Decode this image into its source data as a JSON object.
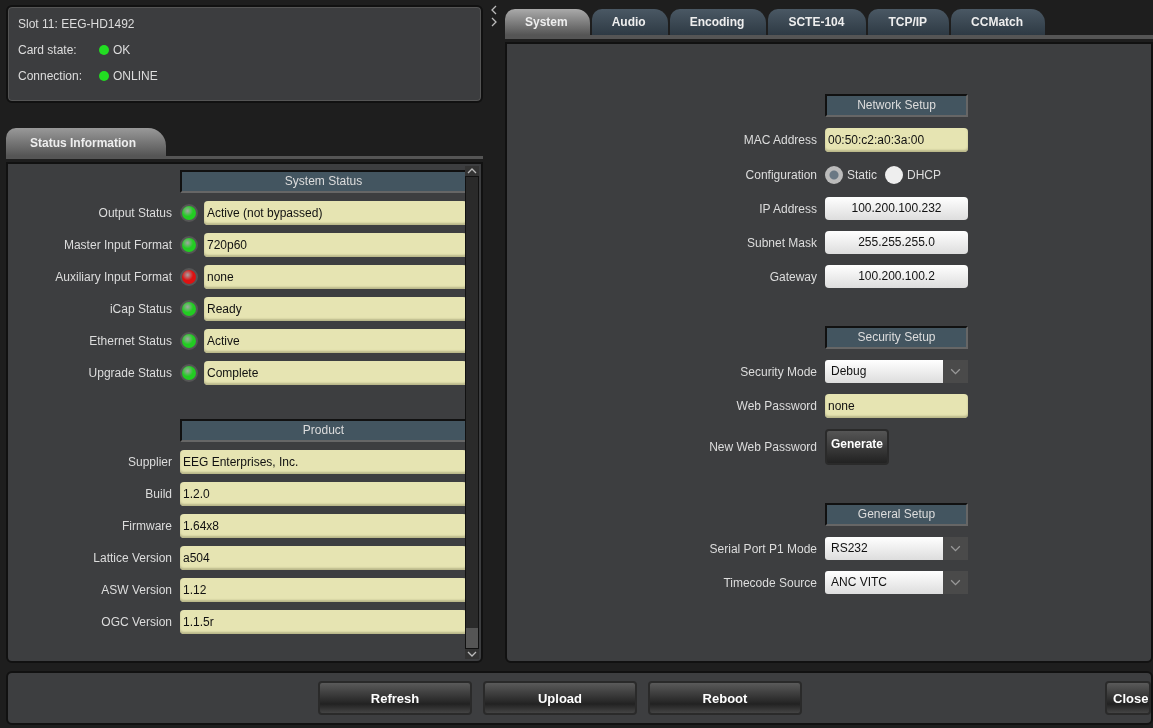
{
  "card": {
    "slot": "Slot 11: EEG-HD1492",
    "lines": [
      {
        "label": "Card state:",
        "value": "OK",
        "color": "#22dd22"
      },
      {
        "label": "Connection:",
        "value": "ONLINE",
        "color": "#22dd22"
      }
    ]
  },
  "left_tabs": [
    {
      "label": "Status Information",
      "selected": true
    }
  ],
  "status_sections": [
    {
      "title": "System Status",
      "rows": [
        {
          "label": "Output Status",
          "value": "Active (not bypassed)",
          "color": "#22cc22"
        },
        {
          "label": "Master Input Format",
          "value": "720p60",
          "color": "#22cc22"
        },
        {
          "label": "Auxiliary Input Format",
          "value": "none",
          "color": "#dd1111"
        },
        {
          "label": "iCap Status",
          "value": "Ready",
          "color": "#22cc22"
        },
        {
          "label": "Ethernet Status",
          "value": "Active",
          "color": "#22cc22"
        },
        {
          "label": "Upgrade Status",
          "value": "Complete",
          "color": "#22cc22"
        }
      ]
    },
    {
      "title": "Product",
      "rows": [
        {
          "label": "Supplier",
          "value": "EEG Enterprises, Inc."
        },
        {
          "label": "Build",
          "value": "1.2.0"
        },
        {
          "label": "Firmware",
          "value": "1.64x8"
        },
        {
          "label": "Lattice Version",
          "value": "a504"
        },
        {
          "label": "ASW Version",
          "value": "1.12"
        },
        {
          "label": "OGC Version",
          "value": "1.1.5r"
        }
      ]
    }
  ],
  "tabs": [
    {
      "label": "System",
      "selected": true
    },
    {
      "label": "Audio",
      "selected": false
    },
    {
      "label": "Encoding",
      "selected": false
    },
    {
      "label": "SCTE-104",
      "selected": false
    },
    {
      "label": "TCP/IP",
      "selected": false
    },
    {
      "label": "CCMatch",
      "selected": false
    }
  ],
  "settings_sections": [
    {
      "title": "Network Setup",
      "rows": [
        {
          "kind": "readonly",
          "label": "MAC Address",
          "value": "00:50:c2:a0:3a:00"
        },
        {
          "kind": "radio",
          "label": "Configuration",
          "options": [
            {
              "label": "Static",
              "selected": true
            },
            {
              "label": "DHCP",
              "selected": false
            }
          ]
        },
        {
          "kind": "input",
          "label": "IP Address",
          "value": "100.200.100.232"
        },
        {
          "kind": "input",
          "label": "Subnet Mask",
          "value": "255.255.255.0"
        },
        {
          "kind": "input",
          "label": "Gateway",
          "value": "100.200.100.2"
        }
      ]
    },
    {
      "title": "Security Setup",
      "rows": [
        {
          "kind": "select",
          "label": "Security Mode",
          "value": "Debug"
        },
        {
          "kind": "readonly",
          "label": "Web Password",
          "value": "none"
        },
        {
          "kind": "button",
          "label": "New Web Password",
          "value": "Generate"
        }
      ]
    },
    {
      "title": "General Setup",
      "rows": [
        {
          "kind": "select",
          "label": "Serial Port P1 Mode",
          "value": "RS232"
        },
        {
          "kind": "select",
          "label": "Timecode Source",
          "value": "ANC VITC"
        }
      ]
    }
  ],
  "footer_buttons": [
    "Refresh",
    "Upload",
    "Reboot"
  ],
  "close_button": "Close"
}
